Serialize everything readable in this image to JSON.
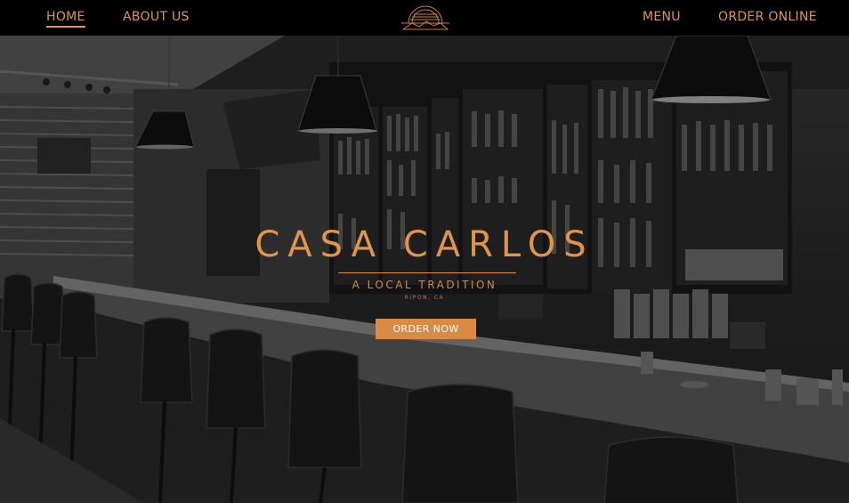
{
  "nav": {
    "home": "HOME",
    "about": "ABOUT US",
    "menu": "MENU",
    "order_online": "ORDER ONLINE"
  },
  "hero": {
    "title": "CASA CARLOS",
    "tagline": "A LOCAL TRADITION",
    "location": "RIPON, CA",
    "cta_label": "ORDER NOW"
  },
  "colors": {
    "accent": "#e0954a",
    "button": "#d98b45",
    "nav_bg": "#000000"
  },
  "icons": [
    "restaurant-logo-icon"
  ]
}
